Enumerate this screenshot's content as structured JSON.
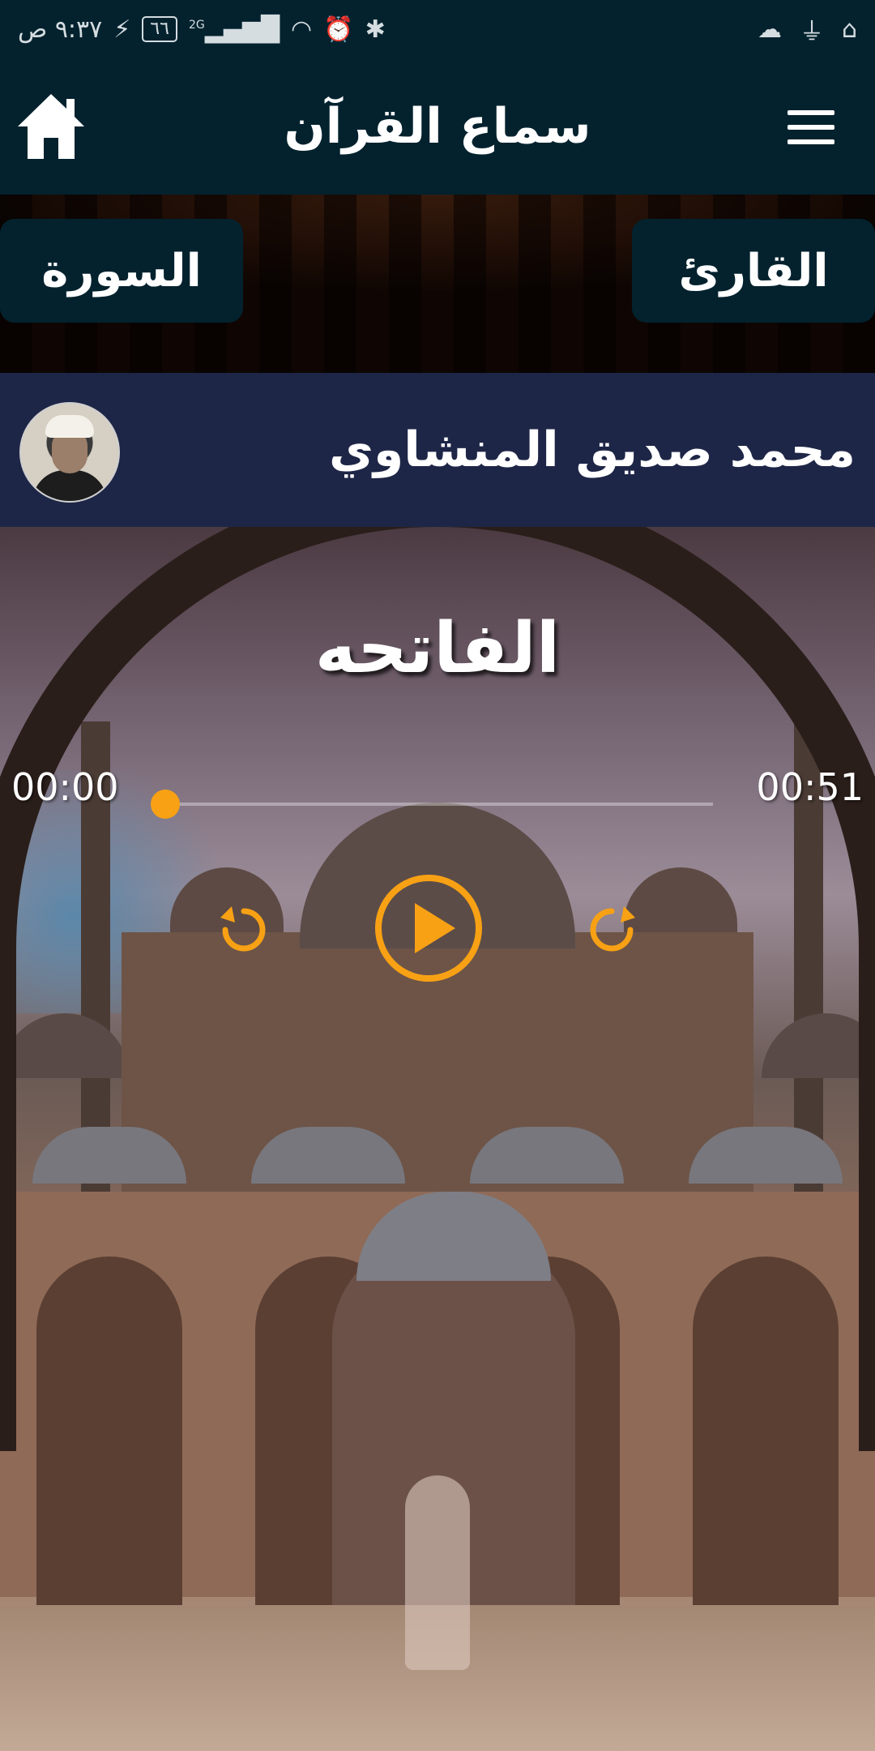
{
  "status_bar": {
    "time": "٩:٣٧ ص",
    "battery": "٦٦",
    "network": "2G",
    "icons_left": [
      "charging-icon",
      "battery-icon",
      "signal-icon",
      "wifi-icon",
      "alarm-icon",
      "bluetooth-icon"
    ],
    "icons_right": [
      "cloud-icon",
      "usb-icon",
      "mosque-icon"
    ]
  },
  "app_bar": {
    "title": "سماع القرآن",
    "home_icon": "home-icon",
    "menu_icon": "menu-icon"
  },
  "buttons": {
    "surah": "السورة",
    "reader": "القارئ"
  },
  "reader": {
    "name": "محمد صديق المنشاوي"
  },
  "player": {
    "surah_name": "الفاتحه",
    "current_time": "00:00",
    "total_time": "00:51",
    "progress": 0,
    "accent_color": "#f8a114"
  },
  "colors": {
    "app_bar": "#03222e",
    "reader_bar": "#1e2647"
  }
}
